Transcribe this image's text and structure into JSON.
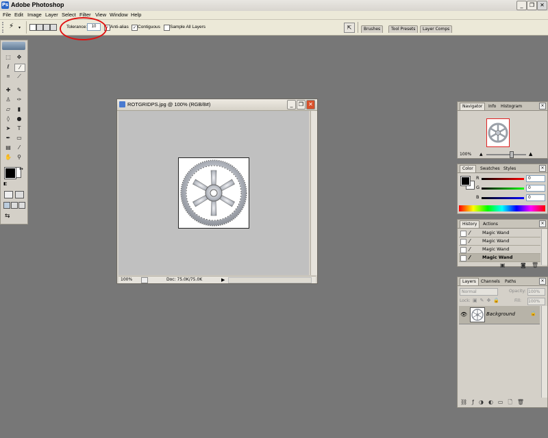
{
  "app": {
    "title": "Adobe Photoshop",
    "icon": "photoshop-icon"
  },
  "window_controls": {
    "minimize": "_",
    "restore": "❐",
    "close": "✕"
  },
  "menu": [
    "File",
    "Edit",
    "Image",
    "Layer",
    "Select",
    "Filter",
    "View",
    "Window",
    "Help"
  ],
  "options": {
    "tolerance_label": "Tolerance:",
    "tolerance_value": "10",
    "anti_alias": "Anti-alias",
    "contiguous": "Contiguous",
    "sample_all_layers": "Sample All Layers",
    "anti_alias_checked": true,
    "contiguous_checked": true,
    "sample_all_checked": false,
    "highlight_color": "#e01010"
  },
  "palette_well": [
    "Brushes",
    "Tool Presets",
    "Layer Comps"
  ],
  "document": {
    "title": "ROTGRIDPS.jpg @ 100% (RGB/8#)",
    "zoom": "100%",
    "doc_info": "Doc: 75.0K/75.0K"
  },
  "navigator": {
    "tabs": [
      "Navigator",
      "Info",
      "Histogram"
    ],
    "zoom": "100%",
    "view_box_color": "#e02020"
  },
  "color": {
    "tabs": [
      "Color",
      "Swatches",
      "Styles"
    ],
    "channels": [
      {
        "label": "R",
        "value": "0",
        "color": "#cc0000"
      },
      {
        "label": "G",
        "value": "0",
        "color": "#00aa00"
      },
      {
        "label": "B",
        "value": "0",
        "color": "#0000cc"
      }
    ],
    "foreground": "#000000",
    "background": "#ffffff"
  },
  "history": {
    "tabs": [
      "History",
      "Actions"
    ],
    "items": [
      "Magic Wand",
      "Magic Wand",
      "Magic Wand",
      "Magic Wand"
    ],
    "active_index": 3
  },
  "layers": {
    "tabs": [
      "Layers",
      "Channels",
      "Paths"
    ],
    "blend_mode": "Normal",
    "opacity_label": "Opacity:",
    "opacity_value": "100%",
    "lock_label": "Lock:",
    "fill_label": "Fill:",
    "fill_value": "100%",
    "layer_name": "Background"
  }
}
